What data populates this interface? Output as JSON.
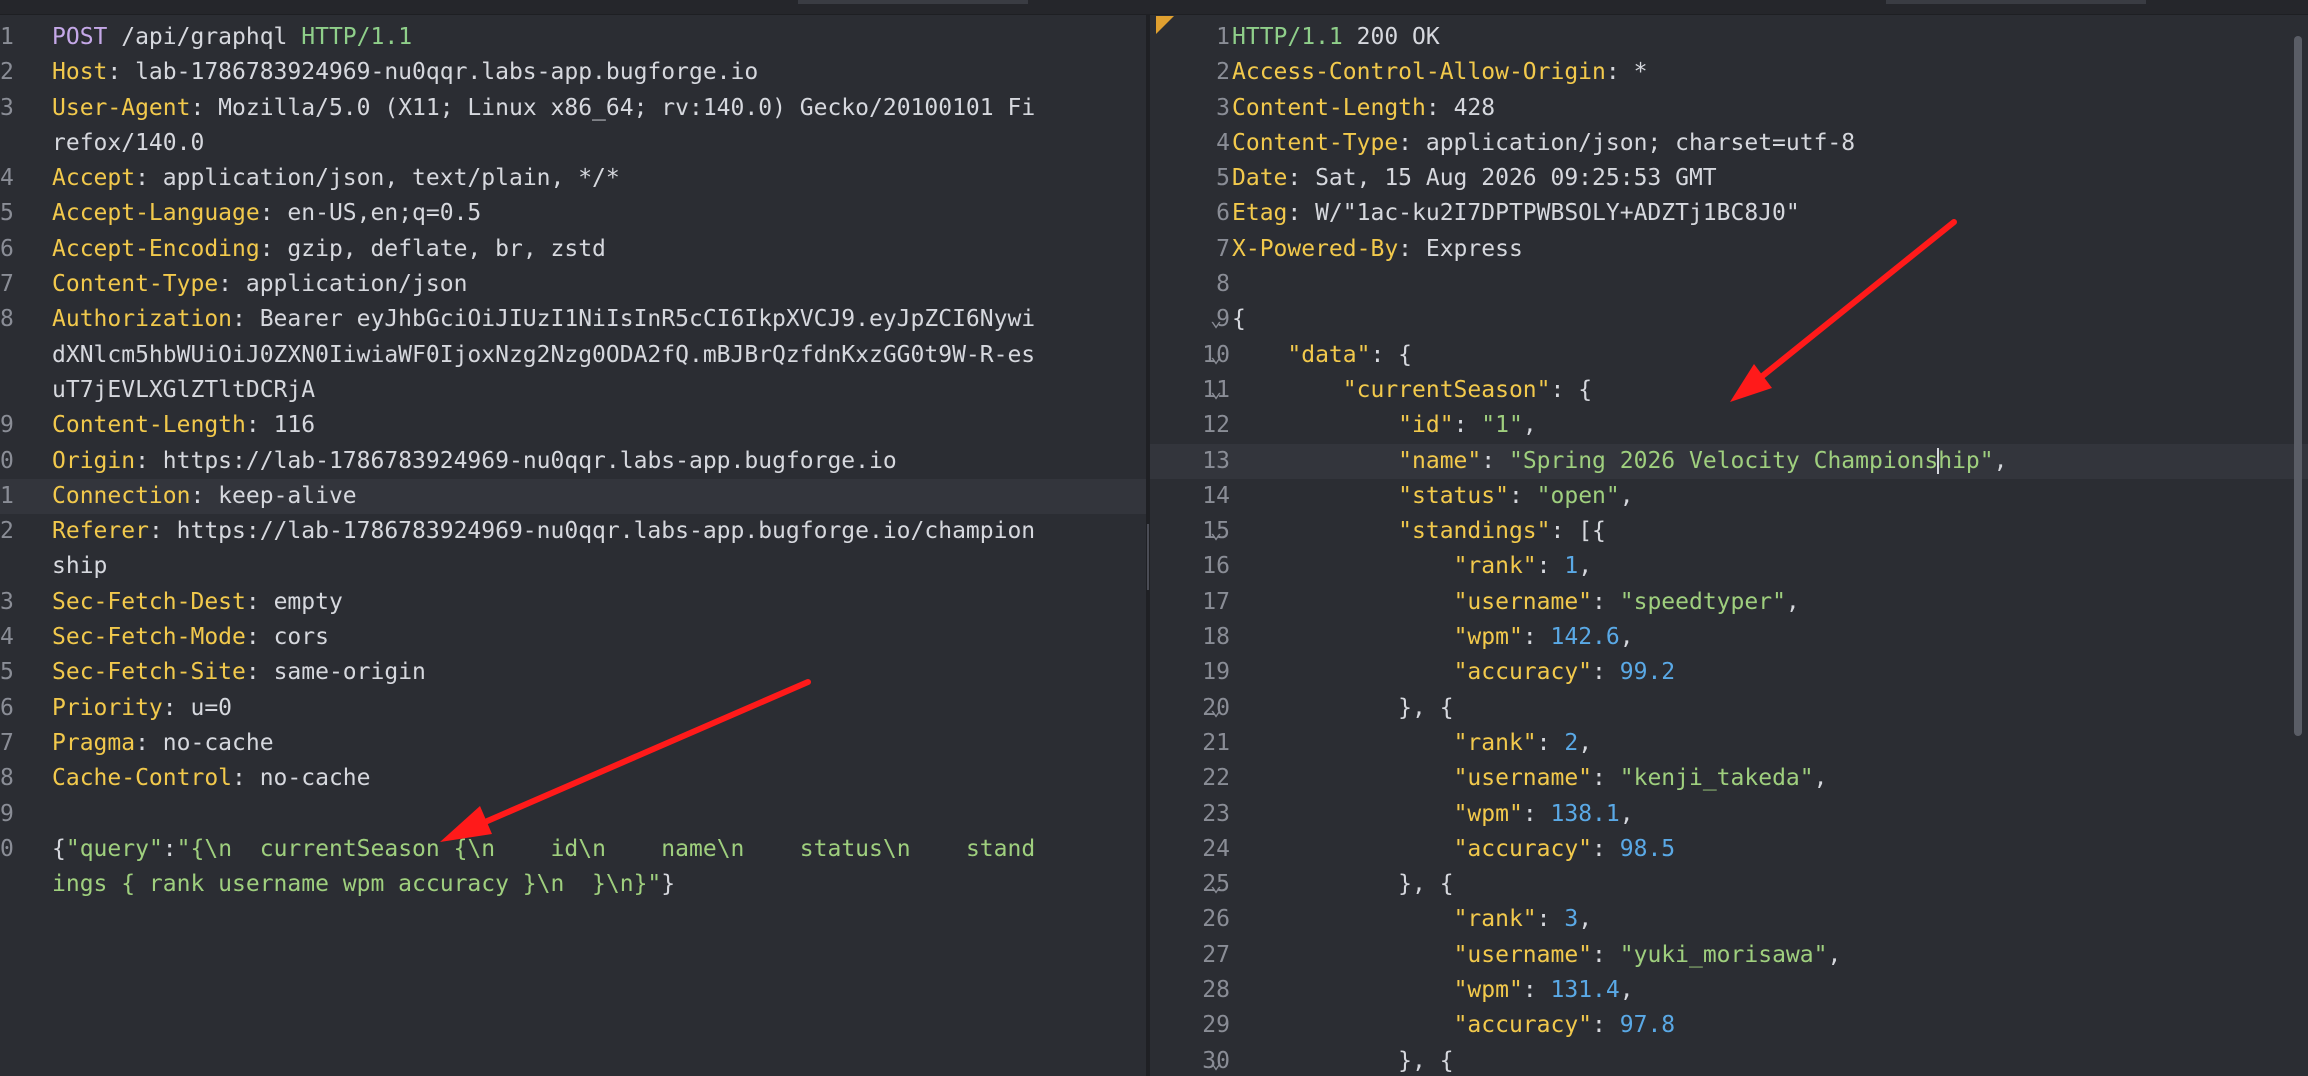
{
  "request": {
    "lines": [
      {
        "n": "1",
        "parts": [
          [
            "method",
            "POST"
          ],
          [
            "plain",
            " /api/graphql "
          ],
          [
            "proto",
            "HTTP/1.1"
          ]
        ]
      },
      {
        "n": "2",
        "parts": [
          [
            "hdr",
            "Host"
          ],
          [
            "plain",
            ": lab-1786783924969-nu0qqr.labs-app.bugforge.io"
          ]
        ]
      },
      {
        "n": "3",
        "parts": [
          [
            "hdr",
            "User-Agent"
          ],
          [
            "plain",
            ": Mozilla/5.0 (X11; Linux x86_64; rv:140.0) Gecko/20100101 Fi"
          ]
        ]
      },
      {
        "n": "",
        "parts": [
          [
            "plain",
            "refox/140.0"
          ]
        ]
      },
      {
        "n": "4",
        "parts": [
          [
            "hdr",
            "Accept"
          ],
          [
            "plain",
            ": application/json, text/plain, */*"
          ]
        ]
      },
      {
        "n": "5",
        "parts": [
          [
            "hdr",
            "Accept-Language"
          ],
          [
            "plain",
            ": en-US,en;q=0.5"
          ]
        ]
      },
      {
        "n": "6",
        "parts": [
          [
            "hdr",
            "Accept-Encoding"
          ],
          [
            "plain",
            ": gzip, deflate, br, zstd"
          ]
        ]
      },
      {
        "n": "7",
        "parts": [
          [
            "hdr",
            "Content-Type"
          ],
          [
            "plain",
            ": application/json"
          ]
        ]
      },
      {
        "n": "8",
        "parts": [
          [
            "hdr",
            "Authorization"
          ],
          [
            "plain",
            ": Bearer eyJhbGciOiJIUzI1NiIsInR5cCI6IkpXVCJ9.eyJpZCI6Nywi"
          ]
        ]
      },
      {
        "n": "",
        "parts": [
          [
            "plain",
            "dXNlcm5hbWUiOiJ0ZXN0IiwiaWF0IjoxNzg2Nzg0ODA2fQ.mBJBrQzfdnKxzGG0t9W-R-es"
          ]
        ]
      },
      {
        "n": "",
        "parts": [
          [
            "plain",
            "uT7jEVLXGlZTltDCRjA"
          ]
        ]
      },
      {
        "n": "9",
        "parts": [
          [
            "hdr",
            "Content-Length"
          ],
          [
            "plain",
            ": 116"
          ]
        ]
      },
      {
        "n": "0",
        "parts": [
          [
            "hdr",
            "Origin"
          ],
          [
            "plain",
            ": https://lab-1786783924969-nu0qqr.labs-app.bugforge.io"
          ]
        ]
      },
      {
        "n": "1",
        "cur": true,
        "parts": [
          [
            "hdr",
            "Connection"
          ],
          [
            "plain",
            ": keep-alive"
          ]
        ]
      },
      {
        "n": "2",
        "parts": [
          [
            "hdr",
            "Referer"
          ],
          [
            "plain",
            ": https://lab-1786783924969-nu0qqr.labs-app.bugforge.io/champion"
          ]
        ]
      },
      {
        "n": "",
        "parts": [
          [
            "plain",
            "ship"
          ]
        ]
      },
      {
        "n": "3",
        "parts": [
          [
            "hdr",
            "Sec-Fetch-Dest"
          ],
          [
            "plain",
            ": empty"
          ]
        ]
      },
      {
        "n": "4",
        "parts": [
          [
            "hdr",
            "Sec-Fetch-Mode"
          ],
          [
            "plain",
            ": cors"
          ]
        ]
      },
      {
        "n": "5",
        "parts": [
          [
            "hdr",
            "Sec-Fetch-Site"
          ],
          [
            "plain",
            ": same-origin"
          ]
        ]
      },
      {
        "n": "6",
        "parts": [
          [
            "hdr",
            "Priority"
          ],
          [
            "plain",
            ": u=0"
          ]
        ]
      },
      {
        "n": "7",
        "parts": [
          [
            "hdr",
            "Pragma"
          ],
          [
            "plain",
            ": no-cache"
          ]
        ]
      },
      {
        "n": "8",
        "parts": [
          [
            "hdr",
            "Cache-Control"
          ],
          [
            "plain",
            ": no-cache"
          ]
        ]
      },
      {
        "n": "9",
        "parts": []
      },
      {
        "n": "0",
        "parts": [
          [
            "plain",
            "{"
          ],
          [
            "str",
            "\"query\""
          ],
          [
            "plain",
            ":"
          ],
          [
            "str",
            "\"{\\n  currentSeason {\\n    id\\n    name\\n    status\\n    stand"
          ]
        ]
      },
      {
        "n": "",
        "parts": [
          [
            "str",
            "ings { rank username wpm accuracy }\\n  }\\n}\""
          ],
          [
            "plain",
            "}"
          ]
        ]
      }
    ]
  },
  "response": {
    "lines": [
      {
        "n": "1",
        "parts": [
          [
            "proto",
            "HTTP/1.1"
          ],
          [
            "plain",
            " 200 OK"
          ]
        ]
      },
      {
        "n": "2",
        "parts": [
          [
            "hdr",
            "Access-Control-Allow-Origin"
          ],
          [
            "plain",
            ": *"
          ]
        ]
      },
      {
        "n": "3",
        "parts": [
          [
            "hdr",
            "Content-Length"
          ],
          [
            "plain",
            ": 428"
          ]
        ]
      },
      {
        "n": "4",
        "parts": [
          [
            "hdr",
            "Content-Type"
          ],
          [
            "plain",
            ": application/json; charset=utf-8"
          ]
        ]
      },
      {
        "n": "5",
        "parts": [
          [
            "hdr",
            "Date"
          ],
          [
            "plain",
            ": Sat, 15 Aug 2026 09:25:53 GMT"
          ]
        ]
      },
      {
        "n": "6",
        "parts": [
          [
            "hdr",
            "Etag"
          ],
          [
            "plain",
            ": W/\"1ac-ku2I7DPTPWBSOLY+ADZTj1BC8J0\""
          ]
        ]
      },
      {
        "n": "7",
        "parts": [
          [
            "hdr",
            "X-Powered-By"
          ],
          [
            "plain",
            ": Express"
          ]
        ]
      },
      {
        "n": "8",
        "parts": []
      },
      {
        "n": "9",
        "fold": true,
        "parts": [
          [
            "plain",
            "{"
          ]
        ]
      },
      {
        "n": "10",
        "fold": true,
        "parts": [
          [
            "plain",
            "    "
          ],
          [
            "key",
            "\"data\""
          ],
          [
            "plain",
            ": {"
          ]
        ]
      },
      {
        "n": "11",
        "fold": true,
        "parts": [
          [
            "plain",
            "        "
          ],
          [
            "key",
            "\"currentSeason\""
          ],
          [
            "plain",
            ": {"
          ]
        ]
      },
      {
        "n": "12",
        "parts": [
          [
            "plain",
            "            "
          ],
          [
            "key",
            "\"id\""
          ],
          [
            "plain",
            ": "
          ],
          [
            "str",
            "\"1\""
          ],
          [
            "plain",
            ","
          ]
        ]
      },
      {
        "n": "13",
        "cur": true,
        "parts": [
          [
            "plain",
            "            "
          ],
          [
            "key",
            "\"name\""
          ],
          [
            "plain",
            ": "
          ],
          [
            "str",
            "\"Spring 2026 Velocity Champions"
          ],
          [
            "cursor",
            ""
          ],
          [
            "str",
            "hip\""
          ],
          [
            "plain",
            ","
          ]
        ]
      },
      {
        "n": "14",
        "parts": [
          [
            "plain",
            "            "
          ],
          [
            "key",
            "\"status\""
          ],
          [
            "plain",
            ": "
          ],
          [
            "str",
            "\"open\""
          ],
          [
            "plain",
            ","
          ]
        ]
      },
      {
        "n": "15",
        "fold": true,
        "parts": [
          [
            "plain",
            "            "
          ],
          [
            "key",
            "\"standings\""
          ],
          [
            "plain",
            ": [{"
          ]
        ]
      },
      {
        "n": "16",
        "parts": [
          [
            "plain",
            "                "
          ],
          [
            "key",
            "\"rank\""
          ],
          [
            "plain",
            ": "
          ],
          [
            "num",
            "1"
          ],
          [
            "plain",
            ","
          ]
        ]
      },
      {
        "n": "17",
        "parts": [
          [
            "plain",
            "                "
          ],
          [
            "key",
            "\"username\""
          ],
          [
            "plain",
            ": "
          ],
          [
            "str",
            "\"speedtyper\""
          ],
          [
            "plain",
            ","
          ]
        ]
      },
      {
        "n": "18",
        "parts": [
          [
            "plain",
            "                "
          ],
          [
            "key",
            "\"wpm\""
          ],
          [
            "plain",
            ": "
          ],
          [
            "num",
            "142.6"
          ],
          [
            "plain",
            ","
          ]
        ]
      },
      {
        "n": "19",
        "parts": [
          [
            "plain",
            "                "
          ],
          [
            "key",
            "\"accuracy\""
          ],
          [
            "plain",
            ": "
          ],
          [
            "num",
            "99.2"
          ]
        ]
      },
      {
        "n": "20",
        "fold": true,
        "parts": [
          [
            "plain",
            "            }, {"
          ]
        ]
      },
      {
        "n": "21",
        "parts": [
          [
            "plain",
            "                "
          ],
          [
            "key",
            "\"rank\""
          ],
          [
            "plain",
            ": "
          ],
          [
            "num",
            "2"
          ],
          [
            "plain",
            ","
          ]
        ]
      },
      {
        "n": "22",
        "parts": [
          [
            "plain",
            "                "
          ],
          [
            "key",
            "\"username\""
          ],
          [
            "plain",
            ": "
          ],
          [
            "str",
            "\"kenji_takeda\""
          ],
          [
            "plain",
            ","
          ]
        ]
      },
      {
        "n": "23",
        "parts": [
          [
            "plain",
            "                "
          ],
          [
            "key",
            "\"wpm\""
          ],
          [
            "plain",
            ": "
          ],
          [
            "num",
            "138.1"
          ],
          [
            "plain",
            ","
          ]
        ]
      },
      {
        "n": "24",
        "parts": [
          [
            "plain",
            "                "
          ],
          [
            "key",
            "\"accuracy\""
          ],
          [
            "plain",
            ": "
          ],
          [
            "num",
            "98.5"
          ]
        ]
      },
      {
        "n": "25",
        "fold": true,
        "parts": [
          [
            "plain",
            "            }, {"
          ]
        ]
      },
      {
        "n": "26",
        "parts": [
          [
            "plain",
            "                "
          ],
          [
            "key",
            "\"rank\""
          ],
          [
            "plain",
            ": "
          ],
          [
            "num",
            "3"
          ],
          [
            "plain",
            ","
          ]
        ]
      },
      {
        "n": "27",
        "parts": [
          [
            "plain",
            "                "
          ],
          [
            "key",
            "\"username\""
          ],
          [
            "plain",
            ": "
          ],
          [
            "str",
            "\"yuki_morisawa\""
          ],
          [
            "plain",
            ","
          ]
        ]
      },
      {
        "n": "28",
        "parts": [
          [
            "plain",
            "                "
          ],
          [
            "key",
            "\"wpm\""
          ],
          [
            "plain",
            ": "
          ],
          [
            "num",
            "131.4"
          ],
          [
            "plain",
            ","
          ]
        ]
      },
      {
        "n": "29",
        "parts": [
          [
            "plain",
            "                "
          ],
          [
            "key",
            "\"accuracy\""
          ],
          [
            "plain",
            ": "
          ],
          [
            "num",
            "97.8"
          ]
        ]
      },
      {
        "n": "30",
        "fold": true,
        "parts": [
          [
            "plain",
            "            }, {"
          ]
        ]
      }
    ]
  },
  "colors": {
    "header_name": "#f2c94c",
    "string": "#9fcf7e",
    "number": "#5aa9e6",
    "method": "#c5a8e8",
    "annotation_arrow": "#ff1a1a"
  },
  "icons": {
    "fold": "chevron-down-icon",
    "arrows": "red-annotation-arrow"
  }
}
